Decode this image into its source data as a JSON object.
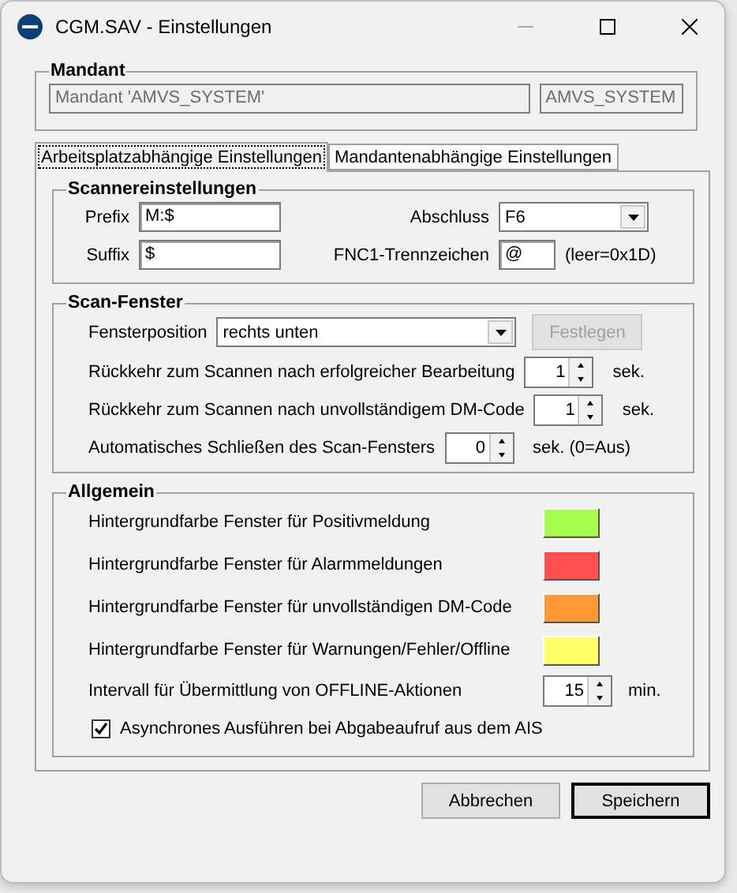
{
  "window": {
    "title": "CGM.SAV - Einstellungen"
  },
  "mandant": {
    "title": "Mandant",
    "name": "Mandant 'AMVS_SYSTEM'",
    "code": "AMVS_SYSTEM"
  },
  "tabs": [
    {
      "label": "Arbeitsplatzabhängige Einstellungen",
      "selected": true
    },
    {
      "label": "Mandantenabhängige Einstellungen",
      "selected": false
    }
  ],
  "scanner": {
    "title": "Scannereinstellungen",
    "prefix": {
      "label": "Prefix",
      "value": "M:$"
    },
    "suffix": {
      "label": "Suffix",
      "value": "$"
    },
    "abschluss": {
      "label": "Abschluss",
      "value": "F6"
    },
    "fnc1": {
      "label": "FNC1-Trennzeichen",
      "value": "@",
      "hint": "(leer=0x1D)"
    }
  },
  "scan_window": {
    "title": "Scan-Fenster",
    "position": {
      "label": "Fensterposition",
      "value": "rechts unten"
    },
    "set_button": {
      "label": "Festlegen",
      "disabled": true
    },
    "spinners": [
      {
        "label": "Rückkehr zum Scannen nach erfolgreicher Bearbeitung",
        "value": "1",
        "unit": "sek."
      },
      {
        "label": "Rückkehr zum Scannen nach unvollständigem DM-Code",
        "value": "1",
        "unit": "sek."
      },
      {
        "label": "Automatisches Schließen des Scan-Fensters",
        "value": "0",
        "unit": "sek. (0=Aus)"
      }
    ]
  },
  "general": {
    "title": "Allgemein",
    "colors": [
      {
        "label": "Hintergrundfarbe Fenster für Positivmeldung",
        "color": "#a6ff4d"
      },
      {
        "label": "Hintergrundfarbe Fenster für Alarmmeldungen",
        "color": "#ff4f4f"
      },
      {
        "label": "Hintergrundfarbe Fenster für unvollständigen DM-Code",
        "color": "#ff9933"
      },
      {
        "label": "Hintergrundfarbe Fenster für Warnungen/Fehler/Offline",
        "color": "#ffff66"
      }
    ],
    "interval": {
      "label": "Intervall für Übermittlung von OFFLINE-Aktionen",
      "value": "15",
      "unit": "min."
    },
    "async": {
      "label": "Asynchrones Ausführen bei Abgabeaufruf aus dem AIS",
      "checked": true
    }
  },
  "buttons": [
    {
      "label": "Abbrechen",
      "default": false
    },
    {
      "label": "Speichern",
      "default": true
    }
  ]
}
